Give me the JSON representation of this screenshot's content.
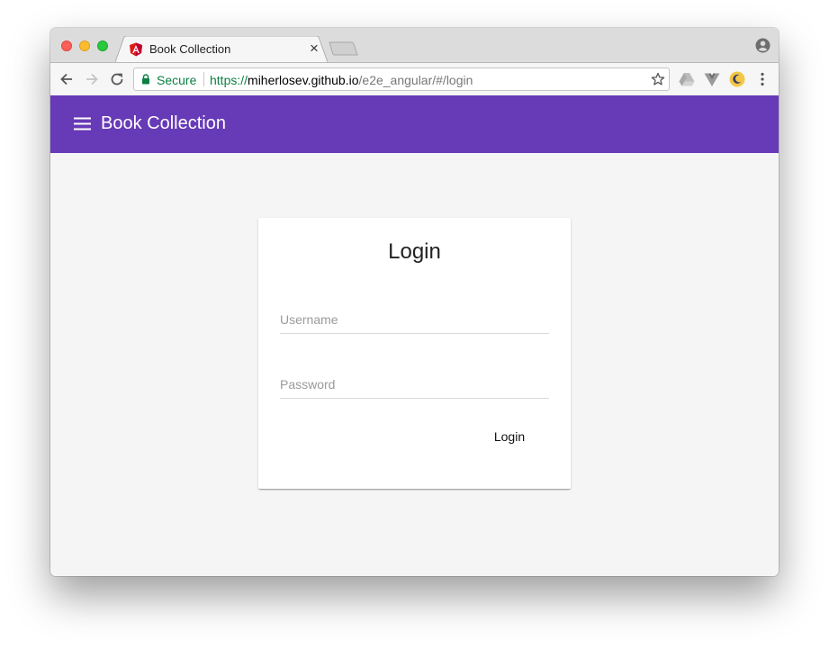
{
  "browser": {
    "tab": {
      "title": "Book Collection"
    },
    "toolbar": {
      "secure_label": "Secure",
      "url": {
        "scheme": "https://",
        "host": "miherlosev.github.io",
        "path": "/e2e_angular/#/login"
      }
    },
    "icons": {
      "favicon": "angular-icon",
      "close": "close-icon",
      "profile": "profile-icon",
      "back": "back-arrow-icon",
      "forward": "forward-arrow-icon",
      "reload": "reload-icon",
      "lock": "lock-icon",
      "bookmark": "star-icon",
      "extensions": [
        "google-drive-icon",
        "vue-devtools-icon",
        "night-mode-icon"
      ],
      "menu": "kebab-menu-icon"
    }
  },
  "app": {
    "title": "Book Collection",
    "accent_color": "#673ab7",
    "menu_icon": "hamburger-menu-icon"
  },
  "login": {
    "title": "Login",
    "username": {
      "value": "",
      "placeholder": "Username"
    },
    "password": {
      "value": "",
      "placeholder": "Password"
    },
    "submit_label": "Login"
  }
}
